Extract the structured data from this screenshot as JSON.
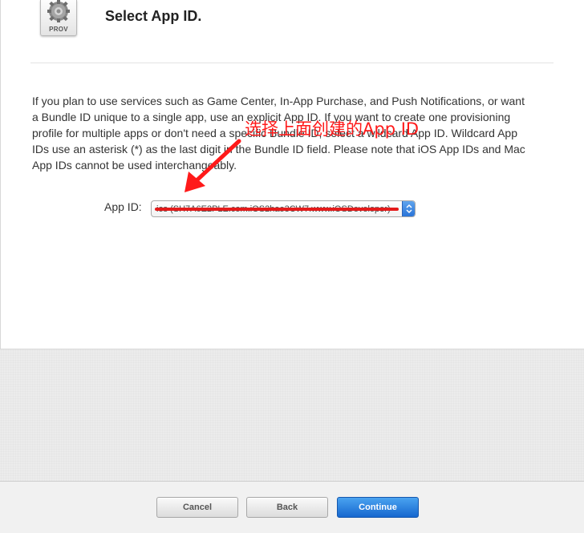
{
  "header": {
    "icon_label": "PROV",
    "title": "Select App ID."
  },
  "description": "If you plan to use services such as Game Center, In-App Purchase, and Push Notifications, or want a Bundle ID unique to a single app, use an explicit App ID. If you want to create one provisioning profile for multiple apps or don't need a specific Bundle ID, select a wildcard App ID. Wildcard App IDs use an asterisk (*) as the last digit in the Bundle ID field. Please note that iOS App IDs and Mac App IDs cannot be used interchangeably.",
  "form": {
    "app_id_label": "App ID:",
    "app_id_value": "ios (SH7A6E2PLE.com.iOS2hao3CW7.www.iOSDeveloper)"
  },
  "annotation": {
    "text": "选择上面创建的App ID",
    "color": "#ff1a1a"
  },
  "footer": {
    "cancel_label": "Cancel",
    "back_label": "Back",
    "continue_label": "Continue"
  },
  "colors": {
    "primary_button": "#1f6fd6",
    "annotation_red": "#ff1a1a"
  },
  "icons": [
    "gear-icon",
    "stepper-icon"
  ]
}
